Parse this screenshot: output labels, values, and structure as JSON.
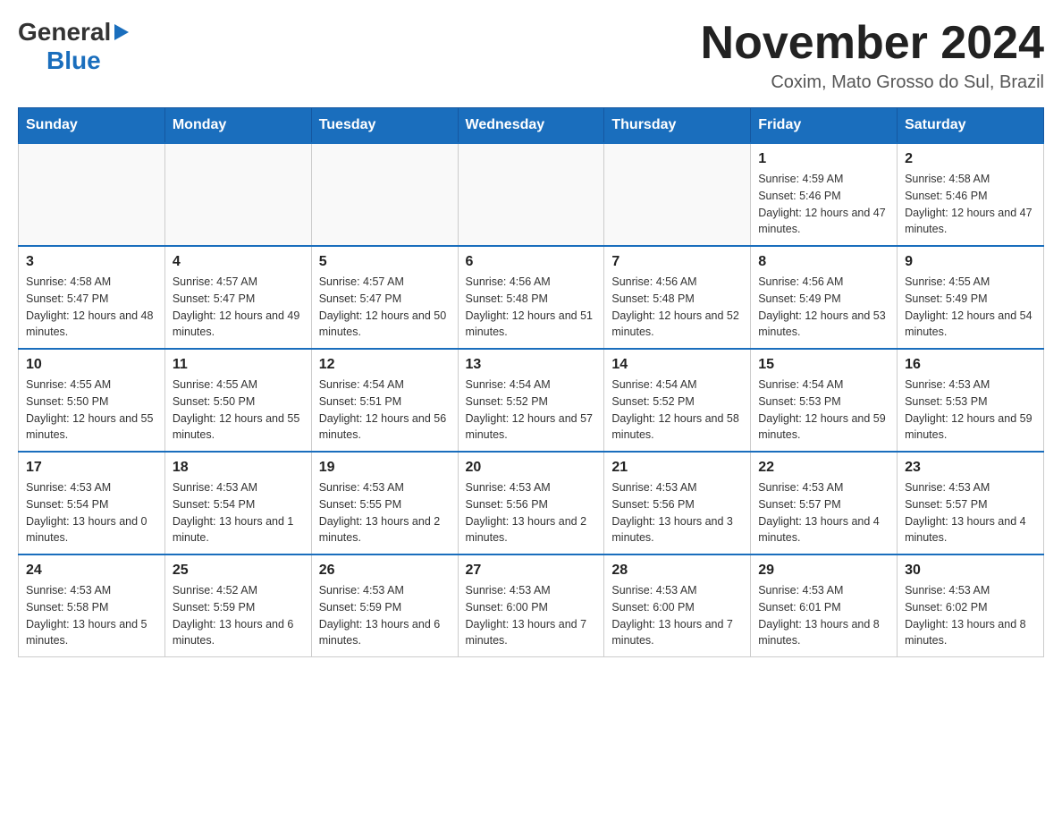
{
  "header": {
    "logo_general": "General",
    "logo_blue": "Blue",
    "title": "November 2024",
    "subtitle": "Coxim, Mato Grosso do Sul, Brazil"
  },
  "weekdays": [
    "Sunday",
    "Monday",
    "Tuesday",
    "Wednesday",
    "Thursday",
    "Friday",
    "Saturday"
  ],
  "weeks": [
    [
      {
        "day": "",
        "sunrise": "",
        "sunset": "",
        "daylight": ""
      },
      {
        "day": "",
        "sunrise": "",
        "sunset": "",
        "daylight": ""
      },
      {
        "day": "",
        "sunrise": "",
        "sunset": "",
        "daylight": ""
      },
      {
        "day": "",
        "sunrise": "",
        "sunset": "",
        "daylight": ""
      },
      {
        "day": "",
        "sunrise": "",
        "sunset": "",
        "daylight": ""
      },
      {
        "day": "1",
        "sunrise": "Sunrise: 4:59 AM",
        "sunset": "Sunset: 5:46 PM",
        "daylight": "Daylight: 12 hours and 47 minutes."
      },
      {
        "day": "2",
        "sunrise": "Sunrise: 4:58 AM",
        "sunset": "Sunset: 5:46 PM",
        "daylight": "Daylight: 12 hours and 47 minutes."
      }
    ],
    [
      {
        "day": "3",
        "sunrise": "Sunrise: 4:58 AM",
        "sunset": "Sunset: 5:47 PM",
        "daylight": "Daylight: 12 hours and 48 minutes."
      },
      {
        "day": "4",
        "sunrise": "Sunrise: 4:57 AM",
        "sunset": "Sunset: 5:47 PM",
        "daylight": "Daylight: 12 hours and 49 minutes."
      },
      {
        "day": "5",
        "sunrise": "Sunrise: 4:57 AM",
        "sunset": "Sunset: 5:47 PM",
        "daylight": "Daylight: 12 hours and 50 minutes."
      },
      {
        "day": "6",
        "sunrise": "Sunrise: 4:56 AM",
        "sunset": "Sunset: 5:48 PM",
        "daylight": "Daylight: 12 hours and 51 minutes."
      },
      {
        "day": "7",
        "sunrise": "Sunrise: 4:56 AM",
        "sunset": "Sunset: 5:48 PM",
        "daylight": "Daylight: 12 hours and 52 minutes."
      },
      {
        "day": "8",
        "sunrise": "Sunrise: 4:56 AM",
        "sunset": "Sunset: 5:49 PM",
        "daylight": "Daylight: 12 hours and 53 minutes."
      },
      {
        "day": "9",
        "sunrise": "Sunrise: 4:55 AM",
        "sunset": "Sunset: 5:49 PM",
        "daylight": "Daylight: 12 hours and 54 minutes."
      }
    ],
    [
      {
        "day": "10",
        "sunrise": "Sunrise: 4:55 AM",
        "sunset": "Sunset: 5:50 PM",
        "daylight": "Daylight: 12 hours and 55 minutes."
      },
      {
        "day": "11",
        "sunrise": "Sunrise: 4:55 AM",
        "sunset": "Sunset: 5:50 PM",
        "daylight": "Daylight: 12 hours and 55 minutes."
      },
      {
        "day": "12",
        "sunrise": "Sunrise: 4:54 AM",
        "sunset": "Sunset: 5:51 PM",
        "daylight": "Daylight: 12 hours and 56 minutes."
      },
      {
        "day": "13",
        "sunrise": "Sunrise: 4:54 AM",
        "sunset": "Sunset: 5:52 PM",
        "daylight": "Daylight: 12 hours and 57 minutes."
      },
      {
        "day": "14",
        "sunrise": "Sunrise: 4:54 AM",
        "sunset": "Sunset: 5:52 PM",
        "daylight": "Daylight: 12 hours and 58 minutes."
      },
      {
        "day": "15",
        "sunrise": "Sunrise: 4:54 AM",
        "sunset": "Sunset: 5:53 PM",
        "daylight": "Daylight: 12 hours and 59 minutes."
      },
      {
        "day": "16",
        "sunrise": "Sunrise: 4:53 AM",
        "sunset": "Sunset: 5:53 PM",
        "daylight": "Daylight: 12 hours and 59 minutes."
      }
    ],
    [
      {
        "day": "17",
        "sunrise": "Sunrise: 4:53 AM",
        "sunset": "Sunset: 5:54 PM",
        "daylight": "Daylight: 13 hours and 0 minutes."
      },
      {
        "day": "18",
        "sunrise": "Sunrise: 4:53 AM",
        "sunset": "Sunset: 5:54 PM",
        "daylight": "Daylight: 13 hours and 1 minute."
      },
      {
        "day": "19",
        "sunrise": "Sunrise: 4:53 AM",
        "sunset": "Sunset: 5:55 PM",
        "daylight": "Daylight: 13 hours and 2 minutes."
      },
      {
        "day": "20",
        "sunrise": "Sunrise: 4:53 AM",
        "sunset": "Sunset: 5:56 PM",
        "daylight": "Daylight: 13 hours and 2 minutes."
      },
      {
        "day": "21",
        "sunrise": "Sunrise: 4:53 AM",
        "sunset": "Sunset: 5:56 PM",
        "daylight": "Daylight: 13 hours and 3 minutes."
      },
      {
        "day": "22",
        "sunrise": "Sunrise: 4:53 AM",
        "sunset": "Sunset: 5:57 PM",
        "daylight": "Daylight: 13 hours and 4 minutes."
      },
      {
        "day": "23",
        "sunrise": "Sunrise: 4:53 AM",
        "sunset": "Sunset: 5:57 PM",
        "daylight": "Daylight: 13 hours and 4 minutes."
      }
    ],
    [
      {
        "day": "24",
        "sunrise": "Sunrise: 4:53 AM",
        "sunset": "Sunset: 5:58 PM",
        "daylight": "Daylight: 13 hours and 5 minutes."
      },
      {
        "day": "25",
        "sunrise": "Sunrise: 4:52 AM",
        "sunset": "Sunset: 5:59 PM",
        "daylight": "Daylight: 13 hours and 6 minutes."
      },
      {
        "day": "26",
        "sunrise": "Sunrise: 4:53 AM",
        "sunset": "Sunset: 5:59 PM",
        "daylight": "Daylight: 13 hours and 6 minutes."
      },
      {
        "day": "27",
        "sunrise": "Sunrise: 4:53 AM",
        "sunset": "Sunset: 6:00 PM",
        "daylight": "Daylight: 13 hours and 7 minutes."
      },
      {
        "day": "28",
        "sunrise": "Sunrise: 4:53 AM",
        "sunset": "Sunset: 6:00 PM",
        "daylight": "Daylight: 13 hours and 7 minutes."
      },
      {
        "day": "29",
        "sunrise": "Sunrise: 4:53 AM",
        "sunset": "Sunset: 6:01 PM",
        "daylight": "Daylight: 13 hours and 8 minutes."
      },
      {
        "day": "30",
        "sunrise": "Sunrise: 4:53 AM",
        "sunset": "Sunset: 6:02 PM",
        "daylight": "Daylight: 13 hours and 8 minutes."
      }
    ]
  ]
}
